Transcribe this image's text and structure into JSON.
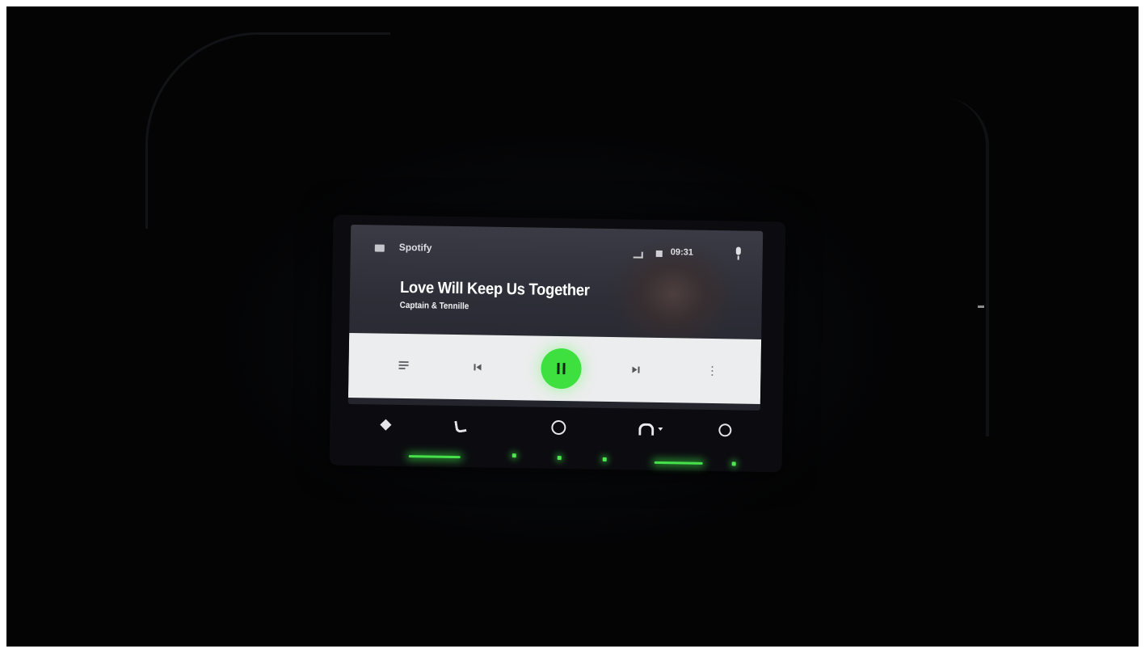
{
  "app": {
    "name": "Spotify",
    "status_time": "09:31"
  },
  "track": {
    "title": "Love Will Keep Us Together",
    "artist": "Captain & Tennille"
  },
  "playback": {
    "state": "playing",
    "accent_color": "#3ee040"
  },
  "icons": {
    "menu": "menu-icon",
    "signal": "signal-icon",
    "battery": "battery-icon",
    "mic": "mic-icon",
    "queue": "queue-icon",
    "previous": "skip-previous-icon",
    "pause": "pause-icon",
    "next": "skip-next-icon",
    "more": "more-vert-icon",
    "maps": "navigation-icon",
    "phone": "phone-icon",
    "home": "home-icon",
    "audio": "headphones-icon",
    "recent": "recents-icon"
  }
}
